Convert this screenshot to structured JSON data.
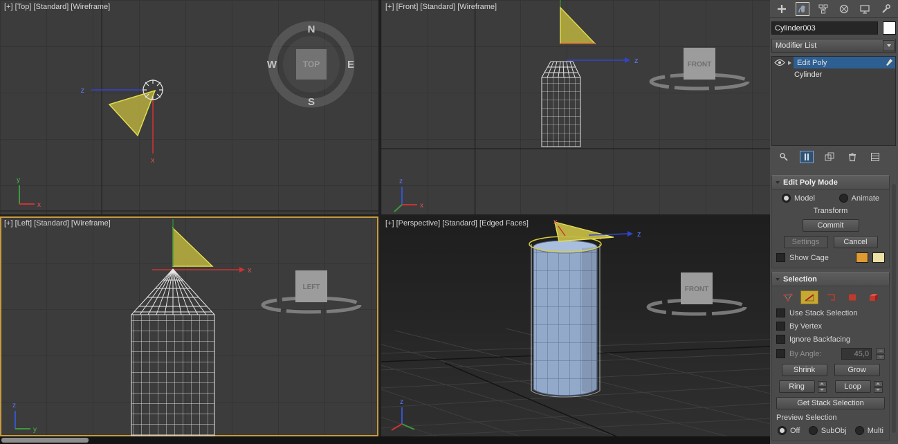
{
  "viewports": {
    "top": {
      "label": "[+] [Top] [Standard] [Wireframe]"
    },
    "front": {
      "label": "[+] [Front] [Standard] [Wireframe]"
    },
    "left": {
      "label": "[+] [Left] [Standard] [Wireframe]"
    },
    "perspective": {
      "label": "[+] [Perspective] [Standard] [Edged Faces]"
    }
  },
  "navigation": {
    "compass": {
      "north": "N",
      "east": "E",
      "south": "S",
      "west": "W",
      "center": "TOP"
    },
    "cube_front": "FRONT",
    "cube_left": "LEFT"
  },
  "axis": {
    "x": "x",
    "y": "y",
    "z": "z"
  },
  "panel": {
    "tabs": [
      "create",
      "modify",
      "hierarchy",
      "motion",
      "display",
      "utilities"
    ],
    "active_tab": "modify",
    "object_name": "Cylinder003",
    "modifier_list_label": "Modifier List",
    "stack": [
      {
        "label": "Edit Poly",
        "selected": true
      },
      {
        "label": "Cylinder",
        "selected": false
      }
    ],
    "stack_tools": [
      "pin-stack",
      "show-end-result",
      "make-unique",
      "remove-modifier",
      "configure-modifier-sets"
    ],
    "edit_poly_mode": {
      "title": "Edit Poly Mode",
      "model_label": "Model",
      "animate_label": "Animate",
      "transform_label": "Transform",
      "commit_label": "Commit",
      "settings_label": "Settings",
      "cancel_label": "Cancel",
      "show_cage_label": "Show Cage",
      "cage_colors": [
        "#df9a31",
        "#ece0a6"
      ]
    },
    "selection": {
      "title": "Selection",
      "subobject_modes": [
        "vertex",
        "edge",
        "border",
        "polygon",
        "element"
      ],
      "active_subobject": "edge",
      "use_stack_selection_label": "Use Stack Selection",
      "by_vertex_label": "By Vertex",
      "ignore_backfacing_label": "Ignore Backfacing",
      "by_angle_label": "By Angle:",
      "by_angle_value": "45,0",
      "shrink_label": "Shrink",
      "grow_label": "Grow",
      "ring_label": "Ring",
      "loop_label": "Loop",
      "get_stack_selection_label": "Get Stack Selection",
      "preview_selection_label": "Preview Selection",
      "preview_options": {
        "off": "Off",
        "subobj": "SubObj",
        "multi": "Multi"
      }
    }
  },
  "colors": {
    "active_viewport_border": "#c99b3c",
    "stack_selection_blue": "#2d5f93",
    "object_yellow": "#b5ab3e",
    "shaded_cylinder": "#93a9c9"
  }
}
